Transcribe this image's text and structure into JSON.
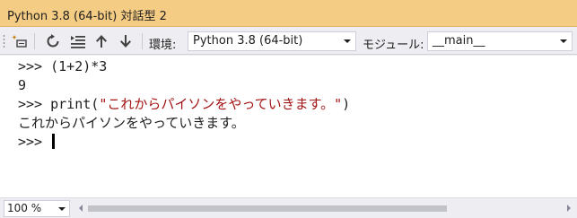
{
  "window": {
    "title": "Python 3.8 (64-bit) 対話型 2"
  },
  "toolbar": {
    "buttons": [
      {
        "icon": "reset-icon",
        "label": "reset"
      },
      {
        "icon": "restart-icon",
        "label": "restart"
      },
      {
        "icon": "list-icon",
        "label": "list"
      },
      {
        "icon": "arrow-up-icon",
        "label": "history-previous"
      },
      {
        "icon": "arrow-down-icon",
        "label": "history-next"
      }
    ],
    "env_label": "環境:",
    "env_value": "Python 3.8 (64-bit)",
    "module_label": "モジュール:",
    "module_value": "__main__"
  },
  "console": {
    "prompt": ">>>",
    "lines": [
      {
        "prompt": ">>>",
        "code": " (1+2)*3"
      },
      {
        "output": "9"
      },
      {
        "prompt": ">>>",
        "code_prefix": " print(",
        "string": "\"これからパイソンをやっていきます。\"",
        "code_suffix": ")"
      },
      {
        "output": "これからパイソンをやっていきます。"
      },
      {
        "prompt": ">>>",
        "code": " "
      }
    ]
  },
  "statusbar": {
    "zoom": "100 %"
  },
  "colors": {
    "titlebar": "#f5cc84",
    "string": "#a31515",
    "accent_icon": "#c27d0e"
  }
}
